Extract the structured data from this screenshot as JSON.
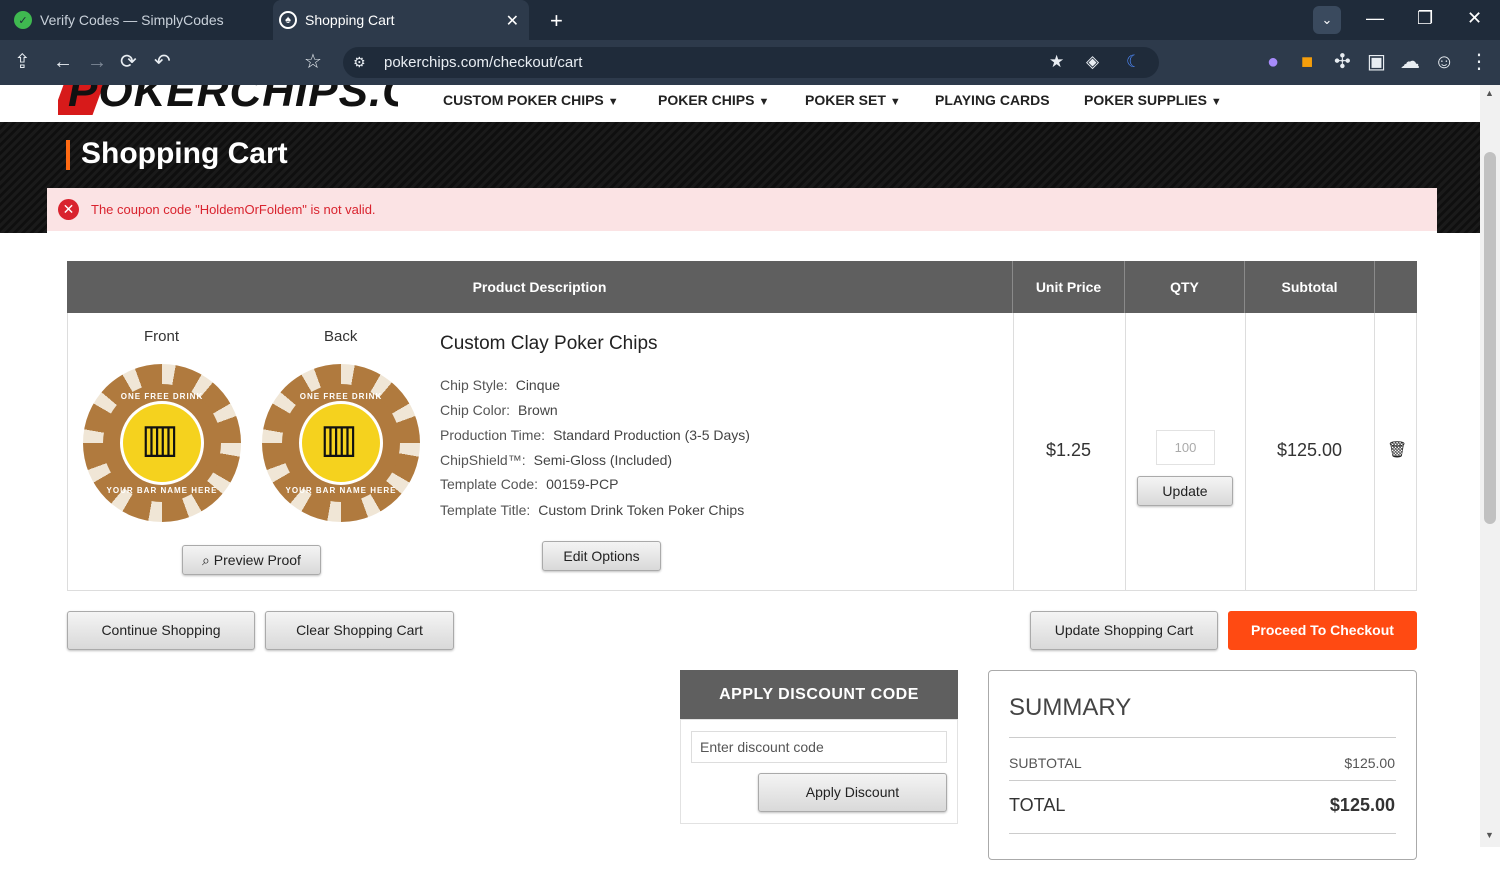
{
  "browser": {
    "tabs": [
      {
        "title": "Verify Codes — SimplyCodes",
        "active": false
      },
      {
        "title": "Shopping Cart",
        "active": true
      }
    ],
    "url": "pokerchips.com/checkout/cart"
  },
  "site": {
    "logo_text": "POKERCHIPS.COM",
    "nav": [
      {
        "label": "CUSTOM POKER CHIPS",
        "has_caret": true
      },
      {
        "label": "POKER CHIPS",
        "has_caret": true
      },
      {
        "label": "POKER SET",
        "has_caret": true
      },
      {
        "label": "PLAYING CARDS",
        "has_caret": false
      },
      {
        "label": "POKER SUPPLIES",
        "has_caret": true
      }
    ],
    "caret": "▼"
  },
  "page": {
    "title": "Shopping Cart",
    "error_message": "The coupon code \"HoldemOrFoldem\" is not valid."
  },
  "table": {
    "headers": {
      "description": "Product Description",
      "unit_price": "Unit Price",
      "qty": "QTY",
      "subtotal": "Subtotal"
    }
  },
  "item": {
    "front_label": "Front",
    "back_label": "Back",
    "chip_top_text": "ONE FREE DRINK",
    "chip_bottom_text": "YOUR BAR NAME HERE",
    "preview_proof": "Preview Proof",
    "name": "Custom Clay Poker Chips",
    "options": [
      {
        "label": "Chip Style:",
        "value": "Cinque"
      },
      {
        "label": "Chip Color:",
        "value": "Brown"
      },
      {
        "label": "Production Time:",
        "value": "Standard Production (3-5 Days)"
      },
      {
        "label": "ChipShield™:",
        "value": "Semi-Gloss (Included)"
      },
      {
        "label": "Template Code:",
        "value": "00159-PCP"
      },
      {
        "label": "Template Title:",
        "value": "Custom Drink Token Poker Chips"
      }
    ],
    "edit_options": "Edit Options",
    "unit_price": "$1.25",
    "qty_placeholder": "100",
    "update": "Update",
    "subtotal": "$125.00"
  },
  "actions": {
    "continue_shopping": "Continue Shopping",
    "clear_cart": "Clear Shopping Cart",
    "update_cart": "Update Shopping Cart",
    "checkout": "Proceed To Checkout"
  },
  "discount": {
    "title": "APPLY DISCOUNT CODE",
    "placeholder": "Enter discount code",
    "apply": "Apply Discount"
  },
  "summary": {
    "title": "SUMMARY",
    "subtotal_label": "SUBTOTAL",
    "subtotal_value": "$125.00",
    "total_label": "TOTAL",
    "total_value": "$125.00"
  },
  "colors": {
    "accent_orange": "#ff4a12",
    "error_red": "#d9232e",
    "header_gray": "#5f5f5f"
  }
}
